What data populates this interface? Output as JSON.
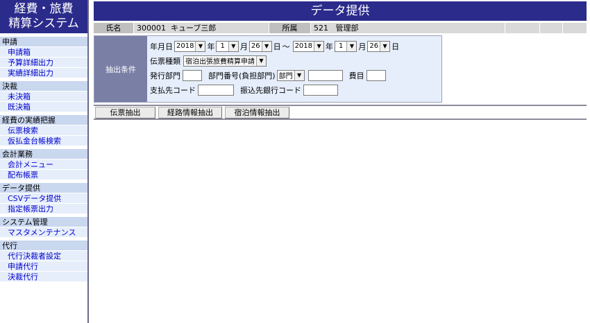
{
  "logo": {
    "line1": "経費・旅費",
    "line2": "精算システム"
  },
  "sidebar": {
    "sections": [
      {
        "title": "申請",
        "items": [
          "申請箱",
          "予算詳細出力",
          "実績詳細出力"
        ]
      },
      {
        "title": "決裁",
        "items": [
          "未決箱",
          "既決箱"
        ]
      },
      {
        "title": "経費の実績把握",
        "items": [
          "伝票検索",
          "仮払金台帳検索"
        ]
      },
      {
        "title": "会計業務",
        "items": [
          "会計メニュー",
          "配布帳票"
        ]
      },
      {
        "title": "データ提供",
        "items": [
          "CSVデータ提供",
          "指定帳票出力"
        ]
      },
      {
        "title": "システム管理",
        "items": [
          "マスタメンテナンス"
        ]
      },
      {
        "title": "代行",
        "items": [
          "代行決裁者設定",
          "申請代行",
          "決裁代行"
        ]
      }
    ]
  },
  "header": {
    "title": "データ提供"
  },
  "info": {
    "name_label": "氏名",
    "name_id": "300001",
    "name_value": "キューブ三郎",
    "dept_label": "所属",
    "dept_code": "521",
    "dept_value": "管理部"
  },
  "filter": {
    "label": "抽出条件",
    "date_label": "年月日",
    "from_year": "2018",
    "from_month": "1",
    "from_day": "26",
    "to_year": "2018",
    "to_month": "1",
    "to_day": "26",
    "unit_year": "年",
    "unit_month": "月",
    "unit_day": "日",
    "range_sep": "～",
    "slip_type_label": "伝票種類",
    "slip_type_value": "宿泊出張旅費精算申請",
    "issuing_dept_label": "発行部門",
    "dept_no_label": "部門番号(負担部門)",
    "dept_no_select": "部門",
    "expense_label": "費目",
    "payee_code_label": "支払先コード",
    "bank_code_label": "振込先銀行コード"
  },
  "tabs": [
    "伝票抽出",
    "経路情報抽出",
    "宿泊情報抽出"
  ]
}
